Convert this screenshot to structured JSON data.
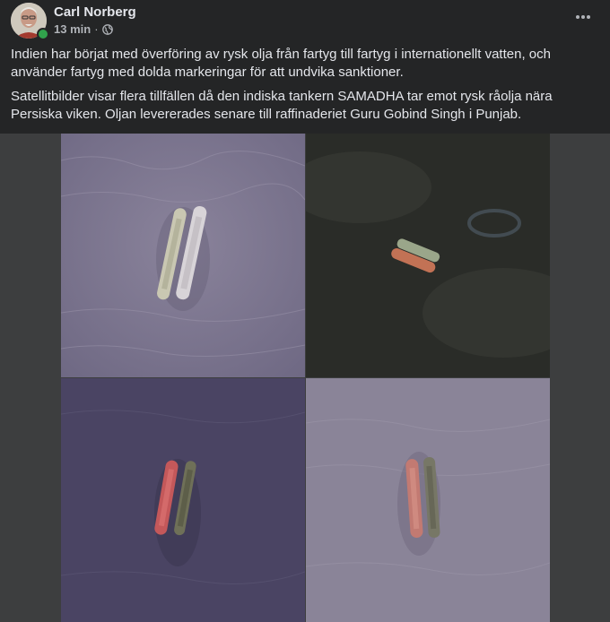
{
  "post": {
    "author": "Carl Norberg",
    "time": "13 min",
    "separator": "·",
    "privacy_icon": "globe-icon",
    "more_icon": "more-horizontal-icon",
    "avatar_icon": "profile-photo",
    "paragraphs": [
      "Indien har börjat med överföring av rysk olja från fartyg till fartyg i internationellt vatten, och använder fartyg med dolda markeringar för att undvika sanktioner.",
      "Satellitbilder visar flera tillfällen då den indiska tankern SAMADHA tar emot rysk råolja nära Persiska viken. Oljan levererades senare till raffinaderiet Guru Gobind Singh i Punjab."
    ]
  },
  "media": {
    "tiles": [
      {
        "name": "satellite-tile-top-left",
        "water_color": "#7b7590",
        "ship_colors": [
          "#c9c7b2",
          "#d8d4d8"
        ]
      },
      {
        "name": "satellite-tile-top-right",
        "water_color": "#2a2c28",
        "ship_colors": [
          "#9aa68a",
          "#c27255"
        ]
      },
      {
        "name": "satellite-tile-bottom-left",
        "water_color": "#4a4463",
        "ship_colors": [
          "#c4585a",
          "#6f7058"
        ]
      },
      {
        "name": "satellite-tile-bottom-right",
        "water_color": "#8a8498",
        "ship_colors": [
          "#c27a72",
          "#777766"
        ]
      }
    ]
  }
}
